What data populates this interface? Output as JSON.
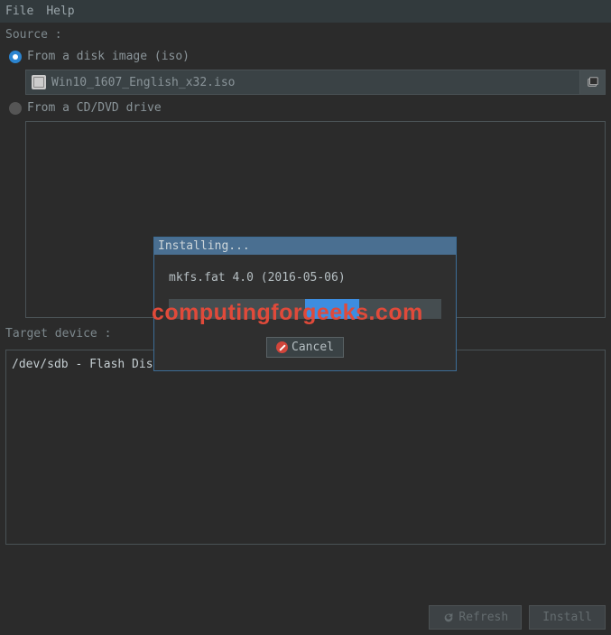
{
  "menubar": {
    "file": "File",
    "help": "Help"
  },
  "source": {
    "label": "Source :",
    "from_iso_label": "From a disk image (iso)",
    "iso_file": "Win10_1607_English_x32.iso",
    "from_cd_label": "From a CD/DVD drive"
  },
  "target": {
    "label": "Target device :",
    "device": "/dev/sdb - Flash Disk -"
  },
  "footer": {
    "refresh": "Refresh",
    "install": "Install"
  },
  "modal": {
    "title": "Installing...",
    "status": "mkfs.fat 4.0 (2016-05-06)",
    "cancel": "Cancel"
  },
  "watermark": "computingforgeeks.com"
}
